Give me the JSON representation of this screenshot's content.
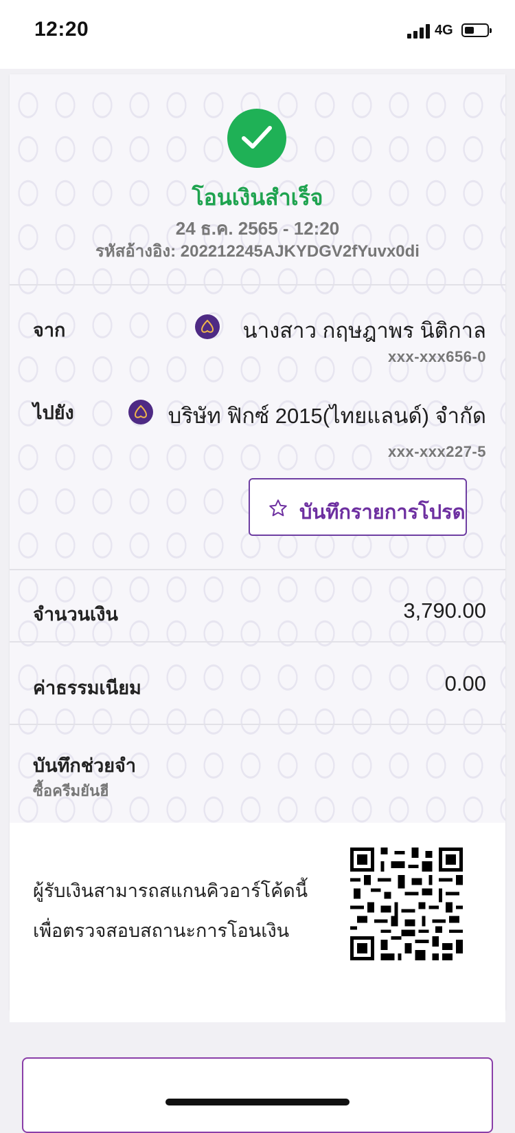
{
  "status_bar": {
    "time": "12:20",
    "network": "4G"
  },
  "receipt": {
    "title": "โอนเงินสำเร็จ",
    "datetime": "24 ธ.ค. 2565 - 12:20",
    "reference": "รหัสอ้างอิง: 202212245AJKYDGV2fYuvx0di",
    "from": {
      "label": "จาก",
      "name": "นางสาว กฤษฎาพร นิติกาล",
      "account": "xxx-xxx656-0",
      "bank_icon": "scb-bank-logo"
    },
    "to": {
      "label": "ไปยัง",
      "name": "บริษัท ฟิกซ์ 2015(ไทยแลนด์) จำกัด",
      "account": "xxx-xxx227-5",
      "bank_icon": "scb-bank-logo"
    },
    "favorite_button": {
      "label": "บันทึกรายการโปรด",
      "icon": "star-outline-icon"
    },
    "amount": {
      "label": "จำนวนเงิน",
      "value": "3,790.00"
    },
    "fee": {
      "label": "ค่าธรรมเนียม",
      "value": "0.00"
    },
    "memo": {
      "label": "บันทึกช่วยจำ",
      "value": "ซื้อครีมยันฮี"
    },
    "qr": {
      "line1": "ผู้รับเงินสามารถสแกนคิวอาร์โค้ดนี้",
      "line2": "เพื่อตรวจสอบสถานะการโอนเงิน"
    }
  },
  "colors": {
    "success_green": "#1fb156",
    "brand_purple": "#4e2a84",
    "button_purple": "#6d2fa0"
  }
}
